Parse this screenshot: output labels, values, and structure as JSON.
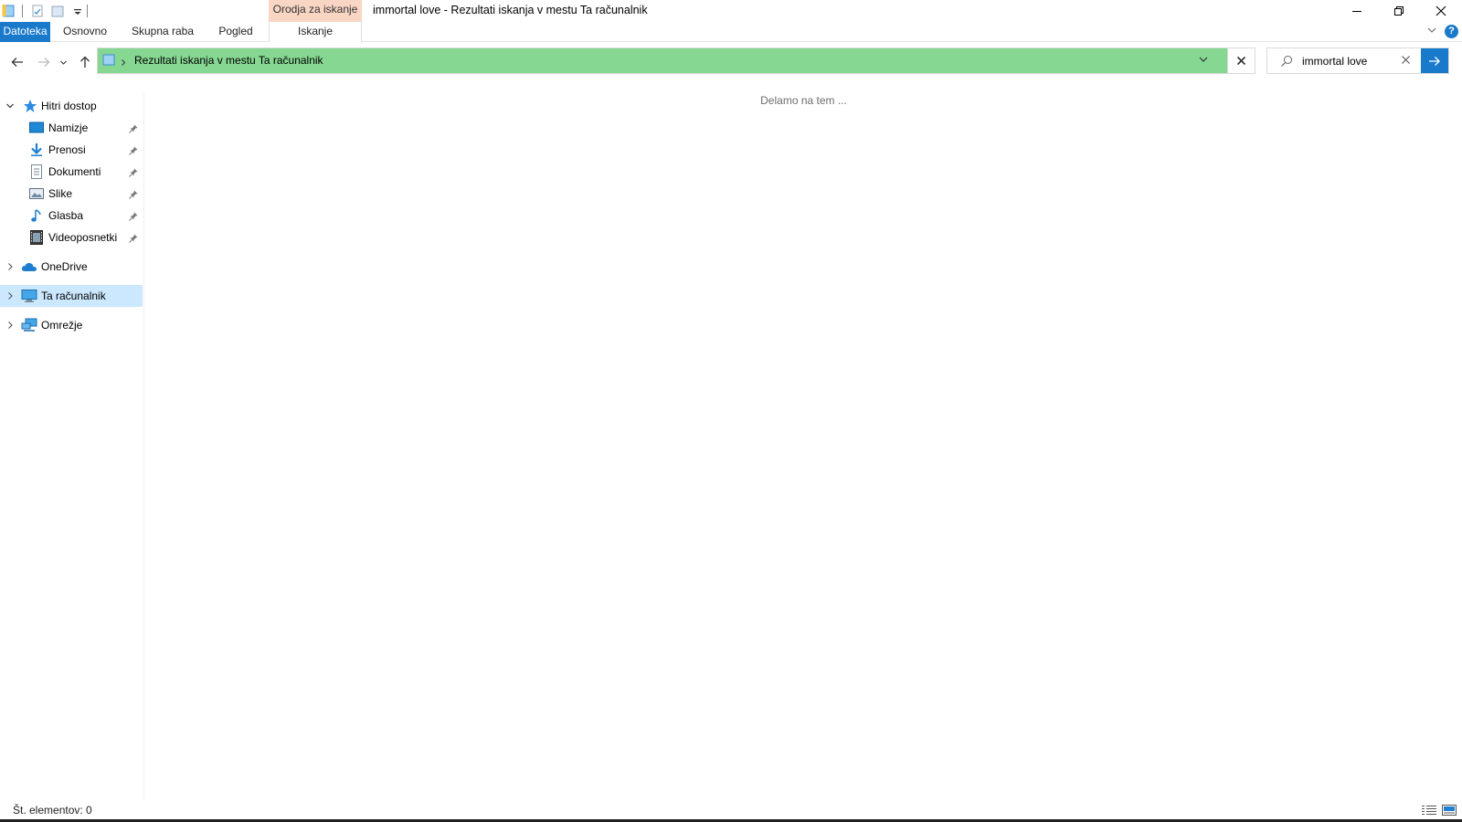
{
  "window": {
    "title": "immortal love - Rezultati iskanja v mestu Ta računalnik",
    "contextual_tab_group": "Orodja za iskanje"
  },
  "ribbon": {
    "tabs": [
      {
        "label": "Datoteka",
        "active": true
      },
      {
        "label": "Osnovno"
      },
      {
        "label": "Skupna raba"
      },
      {
        "label": "Pogled"
      },
      {
        "label": "Iskanje"
      }
    ]
  },
  "address_bar": {
    "breadcrumb": "Rezultati iskanja v mestu Ta računalnik"
  },
  "search": {
    "query": "immortal love"
  },
  "nav_pane": {
    "quick_access": {
      "label": "Hitri dostop",
      "items": [
        {
          "label": "Namizje",
          "icon": "desktop-icon"
        },
        {
          "label": "Prenosi",
          "icon": "downloads-icon"
        },
        {
          "label": "Dokumenti",
          "icon": "documents-icon"
        },
        {
          "label": "Slike",
          "icon": "pictures-icon"
        },
        {
          "label": "Glasba",
          "icon": "music-icon"
        },
        {
          "label": "Videoposnetki",
          "icon": "videos-icon"
        }
      ]
    },
    "onedrive": {
      "label": "OneDrive"
    },
    "this_pc": {
      "label": "Ta računalnik"
    },
    "network": {
      "label": "Omrežje"
    }
  },
  "content": {
    "status_message": "Delamo na tem ..."
  },
  "status_bar": {
    "item_count": "Št. elementov: 0"
  },
  "colors": {
    "accent": "#1979ca",
    "address_progress": "#86d792",
    "contextual_tab": "#f9d6c4",
    "selection": "#cce8ff"
  }
}
